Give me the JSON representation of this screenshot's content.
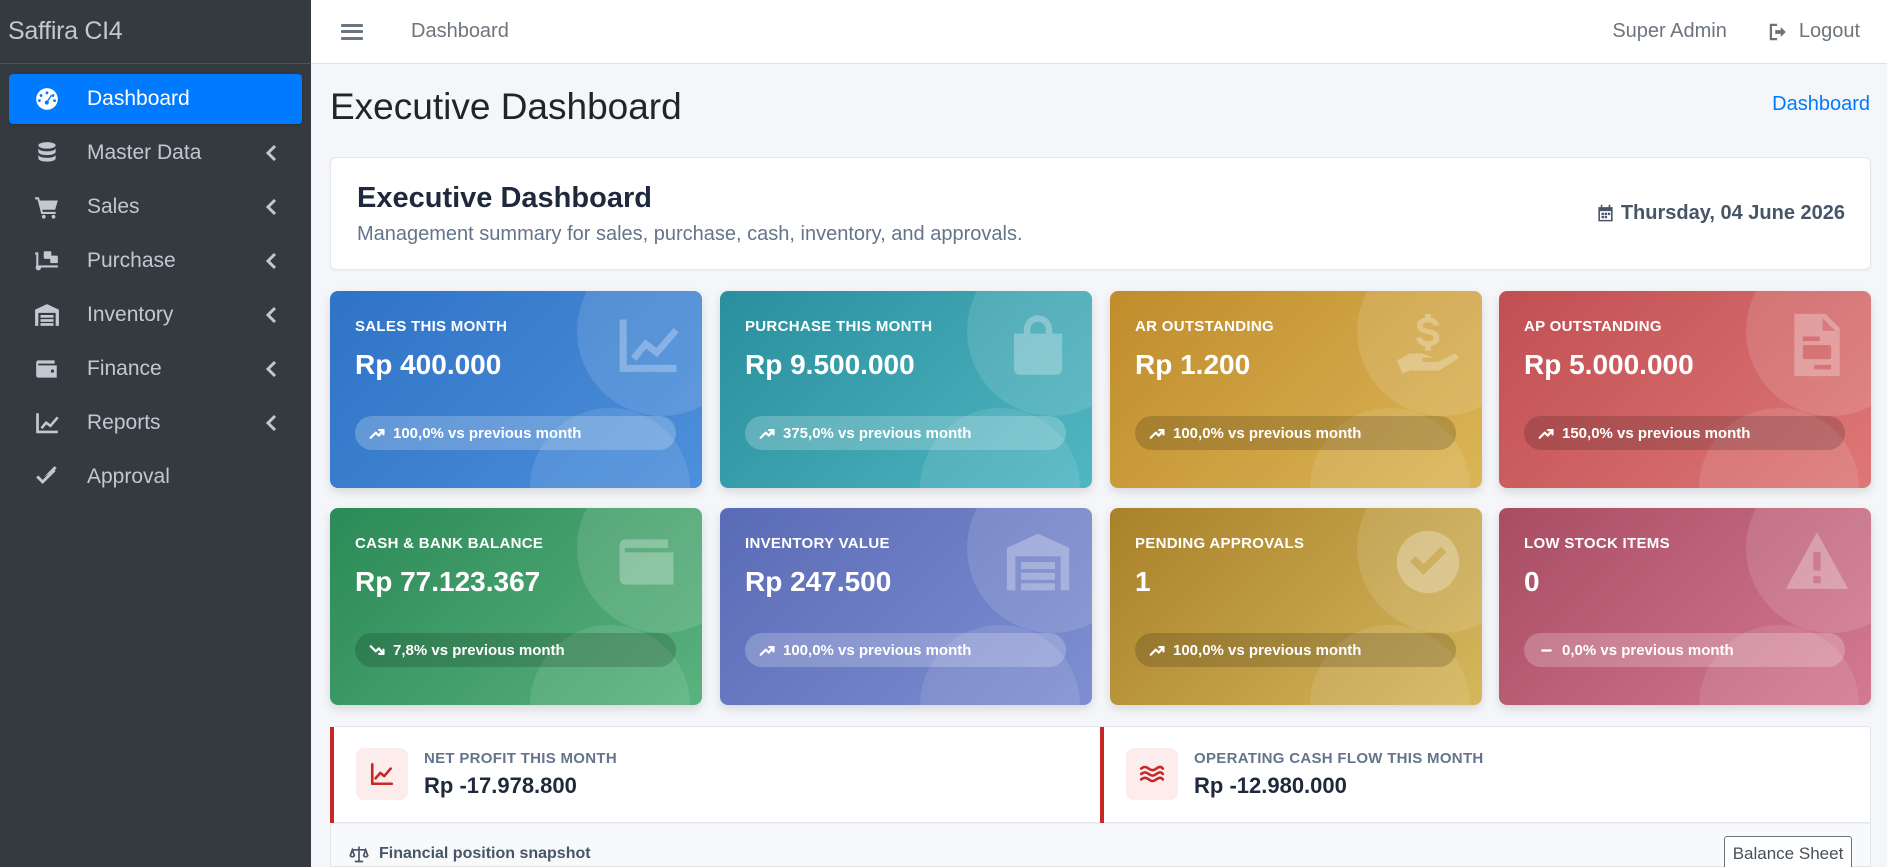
{
  "sidebar": {
    "brand": "Saffira CI4",
    "items": [
      {
        "label": "Dashboard",
        "icon": "tachometer-icon",
        "active": true
      },
      {
        "label": "Master Data",
        "icon": "database-icon"
      },
      {
        "label": "Sales",
        "icon": "cart-icon"
      },
      {
        "label": "Purchase",
        "icon": "truck-loading-icon"
      },
      {
        "label": "Inventory",
        "icon": "warehouse-icon"
      },
      {
        "label": "Finance",
        "icon": "wallet-icon"
      },
      {
        "label": "Reports",
        "icon": "chart-line-icon"
      },
      {
        "label": "Approval",
        "icon": "check-double-icon"
      }
    ]
  },
  "header": {
    "menu_icon": "hamburger-icon",
    "link": "Dashboard",
    "user": "Super Admin",
    "logout": "Logout"
  },
  "content_header": {
    "title": "Executive Dashboard",
    "breadcrumb": "Dashboard"
  },
  "intro": {
    "title": "Executive Dashboard",
    "subtitle": "Management summary for sales, purchase, cash, inventory, and approvals.",
    "date": "Thursday, 04 June 2026"
  },
  "kpis": [
    {
      "label": "SALES THIS MONTH",
      "value": "Rp 400.000",
      "trend": "100,0% vs previous month",
      "trend_dir": "up",
      "icon": "chart-line-icon",
      "color": "#3a7ecf"
    },
    {
      "label": "PURCHASE THIS MONTH",
      "value": "Rp 9.500.000",
      "trend": "375,0% vs previous month",
      "trend_dir": "up",
      "icon": "shopping-bag-icon",
      "color": "#36a2ad"
    },
    {
      "label": "AR OUTSTANDING",
      "value": "Rp 1.200",
      "trend": "100,0% vs previous month",
      "trend_dir": "up",
      "icon": "hand-dollar-icon",
      "color": "#cfa040"
    },
    {
      "label": "AP OUTSTANDING",
      "value": "Rp 5.000.000",
      "trend": "150,0% vs previous month",
      "trend_dir": "up",
      "icon": "invoice-icon",
      "color": "#d06163"
    },
    {
      "label": "CASH & BANK BALANCE",
      "value": "Rp 77.123.367",
      "trend": "7,8% vs previous month",
      "trend_dir": "down",
      "icon": "wallet-icon",
      "color": "#3e9d68"
    },
    {
      "label": "INVENTORY VALUE",
      "value": "Rp 247.500",
      "trend": "100,0% vs previous month",
      "trend_dir": "up",
      "icon": "warehouse-icon",
      "color": "#6b7cc4"
    },
    {
      "label": "PENDING APPROVALS",
      "value": "1",
      "trend": "100,0% vs previous month",
      "trend_dir": "up",
      "icon": "check-circle-icon",
      "color": "#bf9c42"
    },
    {
      "label": "LOW STOCK ITEMS",
      "value": "0",
      "trend": "0,0% vs previous month",
      "trend_dir": "flat",
      "icon": "warning-icon",
      "color": "#be6078"
    }
  ],
  "summary": [
    {
      "label": "NET PROFIT THIS MONTH",
      "value": "Rp -17.978.800",
      "icon": "chart-line-icon"
    },
    {
      "label": "OPERATING CASH FLOW THIS MONTH",
      "value": "Rp -12.980.000",
      "icon": "water-icon"
    }
  ],
  "snapshot": {
    "title": "Financial position snapshot",
    "icon": "balance-scale-icon",
    "button": "Balance Sheet"
  }
}
